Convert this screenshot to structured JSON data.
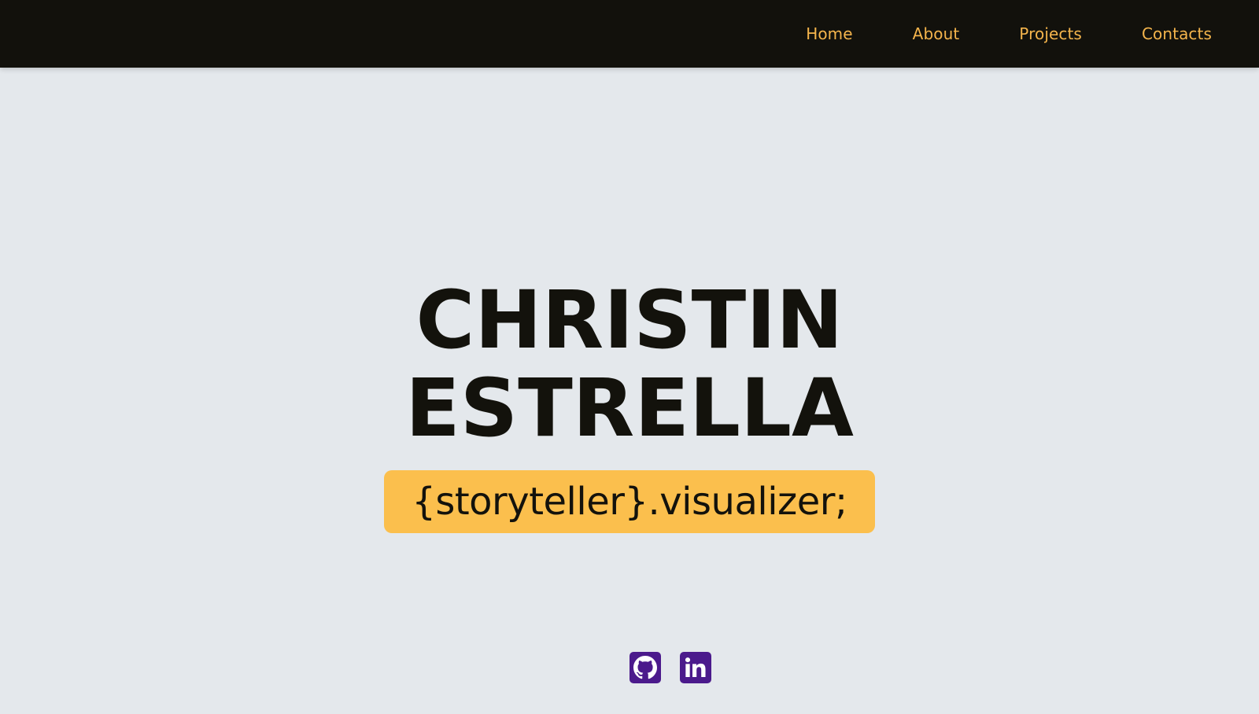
{
  "nav": {
    "items": [
      {
        "label": "Home"
      },
      {
        "label": "About"
      },
      {
        "label": "Projects"
      },
      {
        "label": "Contacts"
      }
    ]
  },
  "hero": {
    "name_line1": "CHRISTIN",
    "name_line2": "ESTRELLA",
    "tagline": "{storyteller}.visualizer;"
  },
  "socials": [
    {
      "icon": "github-icon"
    },
    {
      "icon": "linkedin-icon"
    }
  ],
  "colors": {
    "background": "#e4e8ec",
    "topbar": "#12110c",
    "nav_text": "#f5b54c",
    "accent": "#fbbf4d",
    "social_bg": "#4b1a8c",
    "heading": "#13120c"
  }
}
